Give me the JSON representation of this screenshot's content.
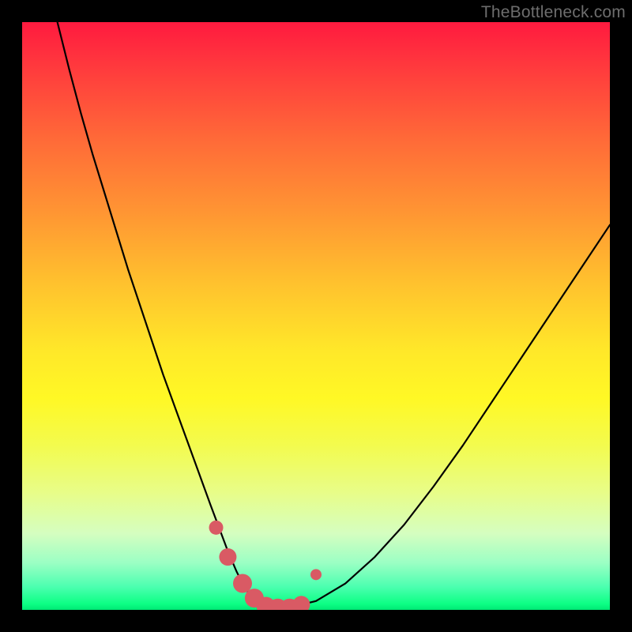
{
  "watermark": "TheBottleneck.com",
  "colors": {
    "frame": "#000000",
    "curve_stroke": "#000000",
    "marker_fill": "#d95a64",
    "marker_stroke": "#c84a54"
  },
  "chart_data": {
    "type": "line",
    "title": "",
    "xlabel": "",
    "ylabel": "",
    "xlim": [
      0,
      100
    ],
    "ylim": [
      0,
      100
    ],
    "grid": false,
    "legend": false,
    "annotations": [
      "TheBottleneck.com"
    ],
    "series": [
      {
        "name": "bottleneck-curve",
        "x": [
          6,
          8,
          10,
          12,
          14,
          16,
          18,
          20,
          22,
          24,
          26,
          28,
          30,
          32,
          33.5,
          35,
          36.5,
          38,
          40,
          42,
          45,
          50,
          55,
          60,
          65,
          70,
          75,
          80,
          85,
          90,
          95,
          100
        ],
        "values": [
          100,
          92,
          84.5,
          77.5,
          71,
          64.5,
          58,
          52,
          46,
          40,
          34.5,
          29,
          23.5,
          18,
          14,
          10,
          6.5,
          3.5,
          1.5,
          0.5,
          0.3,
          1.5,
          4.5,
          9,
          14.5,
          21,
          28,
          35.5,
          43,
          50.5,
          58,
          65.5
        ]
      },
      {
        "name": "minimum-markers",
        "x": [
          33.0,
          35.0,
          37.5,
          39.5,
          41.5,
          43.5,
          45.5,
          47.5,
          50.0
        ],
        "values": [
          14.0,
          9.0,
          4.5,
          2.0,
          0.6,
          0.3,
          0.3,
          0.9,
          6.0
        ],
        "size": [
          9,
          11,
          12,
          12,
          12,
          12,
          12,
          11,
          7
        ]
      }
    ]
  }
}
